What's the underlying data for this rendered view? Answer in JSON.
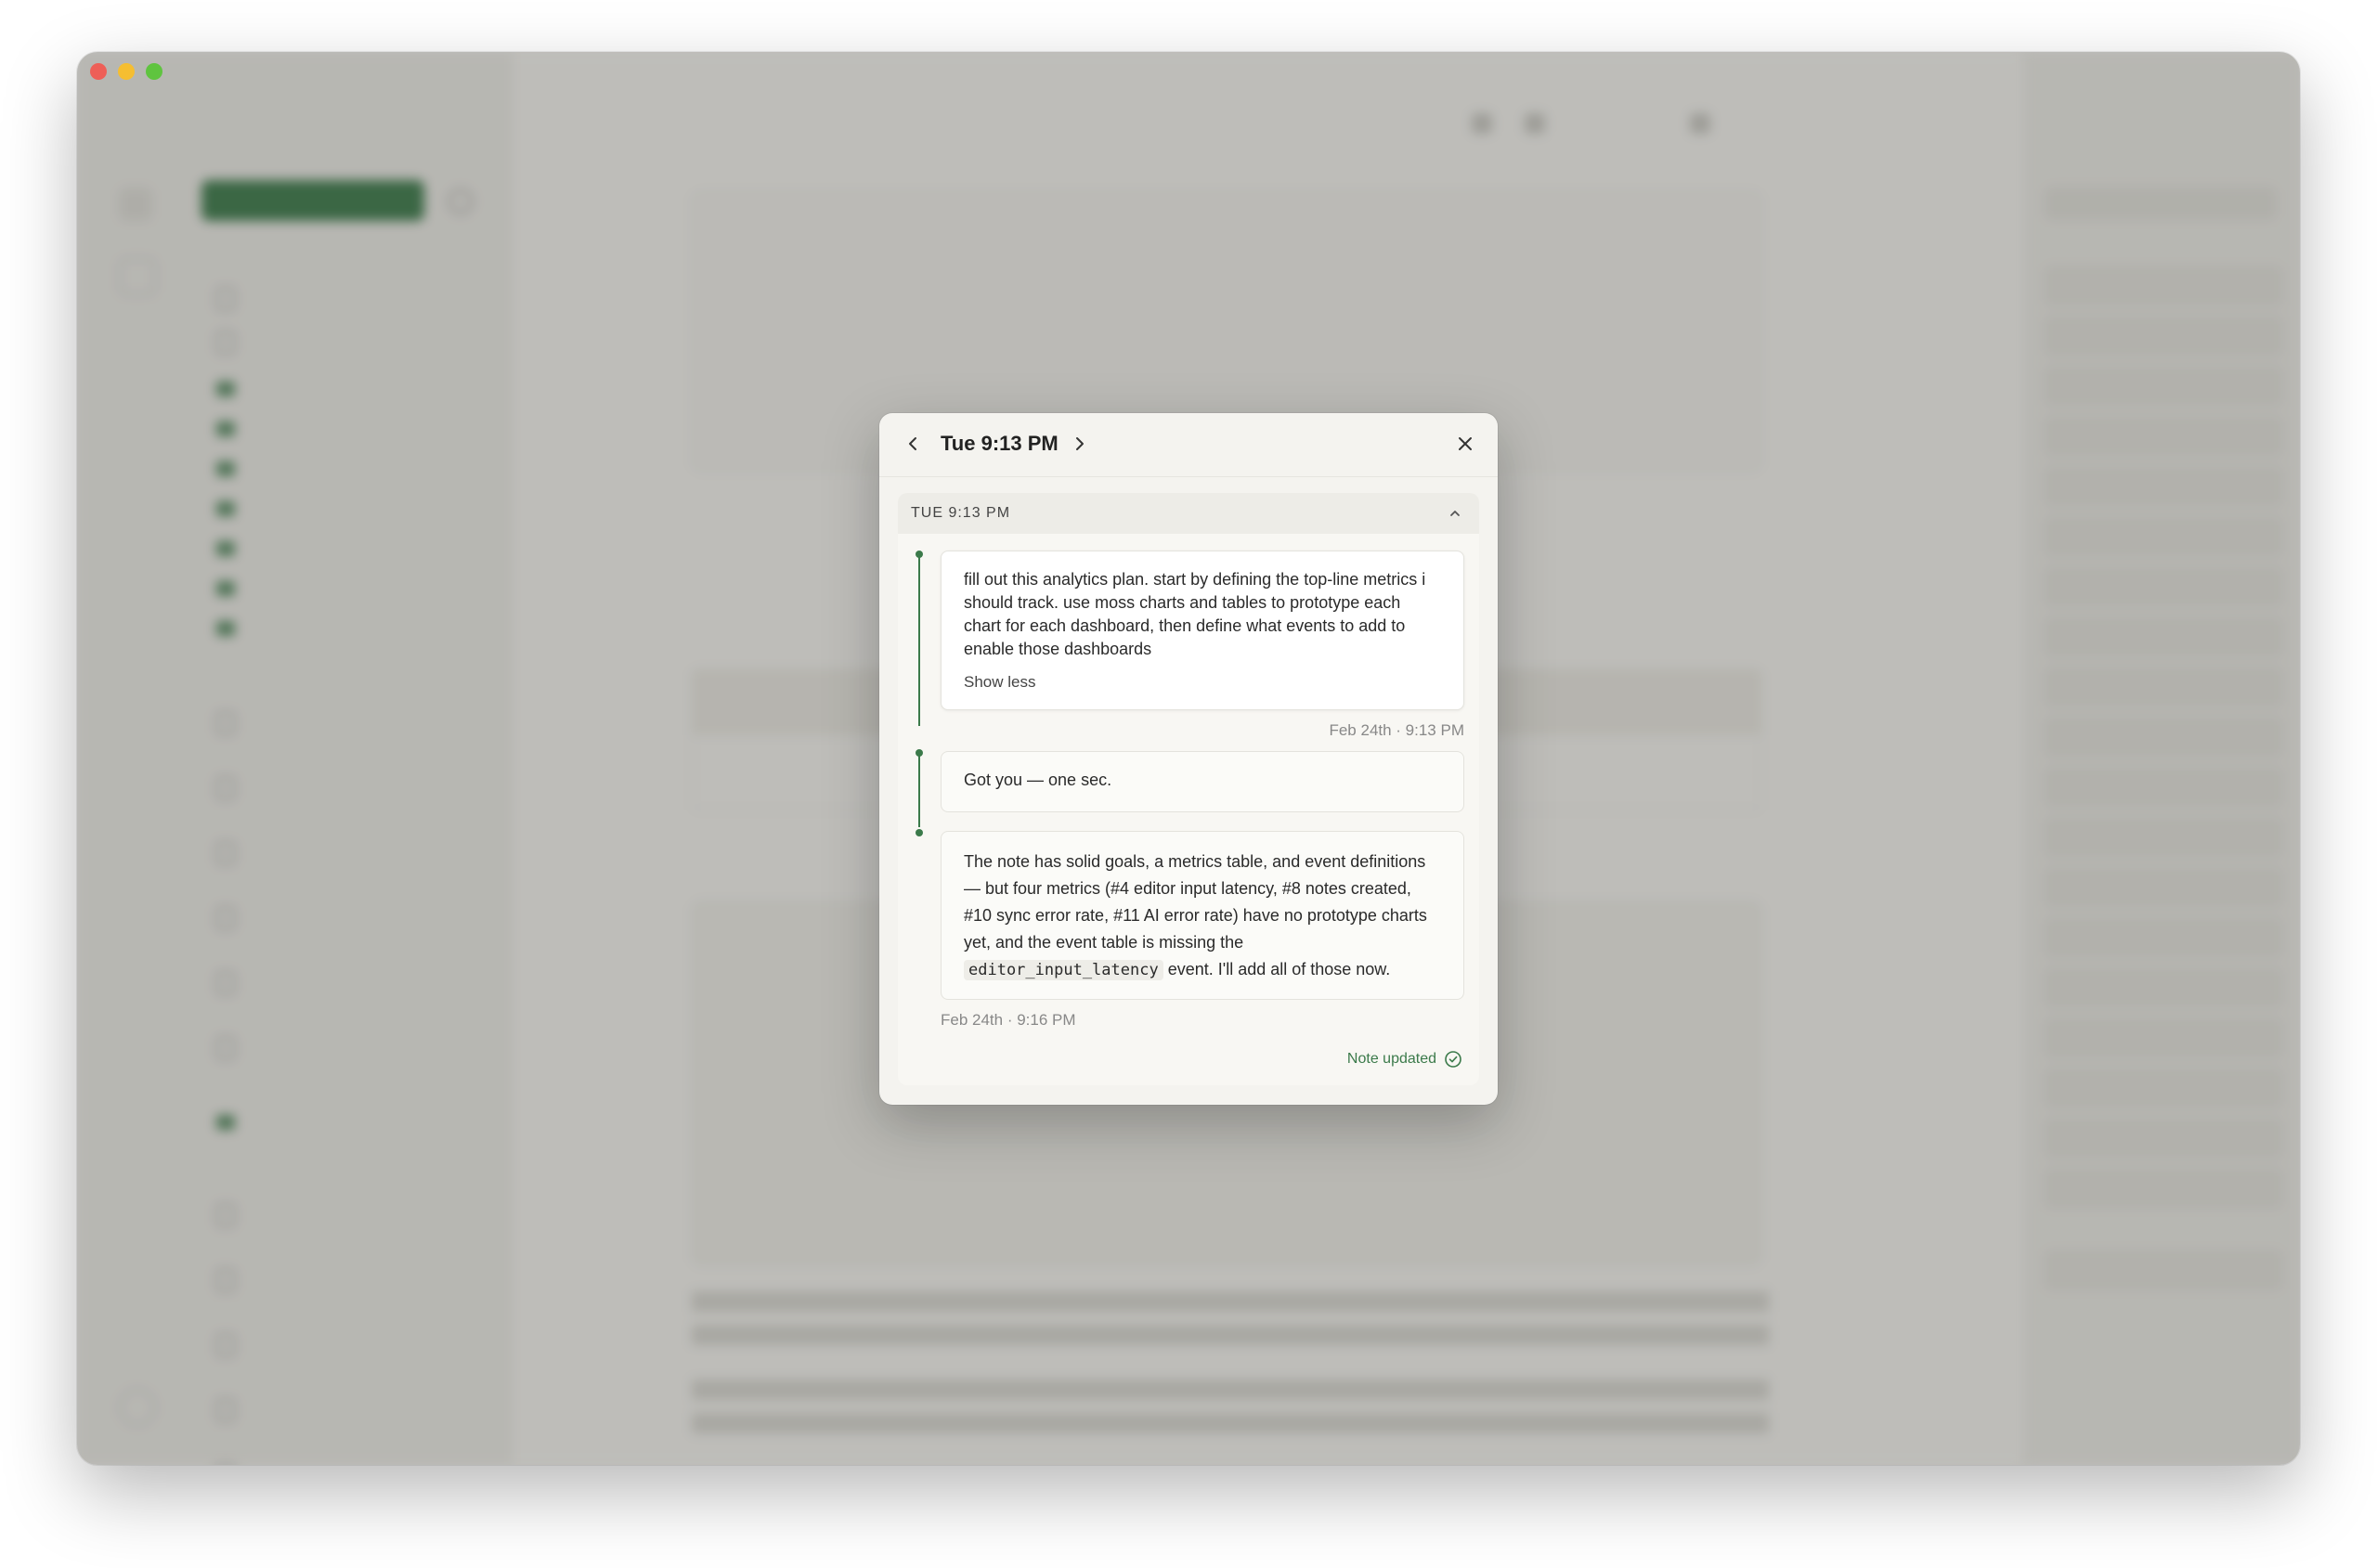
{
  "modal": {
    "title": "Tue 9:13 PM",
    "section_label": "TUE 9:13 PM",
    "messages": [
      {
        "role": "user",
        "text": "fill out this analytics plan. start by defining the top-line metrics i should track. use moss charts and tables to prototype each chart for each dashboard, then define what events to add to enable those dashboards",
        "show_less": "Show less",
        "timestamp": "Feb 24th · 9:13 PM"
      },
      {
        "role": "assistant",
        "text": "Got you — one sec."
      },
      {
        "role": "assistant",
        "text_before": "The note has solid goals, a metrics table, and event definitions — but four metrics (#4 editor input latency, #8 notes created, #10 sync error rate, #11 AI error rate) have no prototype charts yet, and the event table is missing the",
        "code": "editor_input_latency",
        "text_after": "event. I'll add all of those now.",
        "timestamp": "Feb 24th · 9:16 PM"
      }
    ],
    "status": "Note updated",
    "icons": {
      "prev": "chevron-left-icon",
      "next": "chevron-right-icon",
      "close": "close-icon",
      "collapse": "chevron-up-icon",
      "status": "check-circle-icon"
    }
  },
  "colors": {
    "accent": "#3b7a4a",
    "modal_bg": "#f4f3ef",
    "traffic_close": "#ee5f57",
    "traffic_min": "#f5be31",
    "traffic_max": "#5fc43f"
  }
}
